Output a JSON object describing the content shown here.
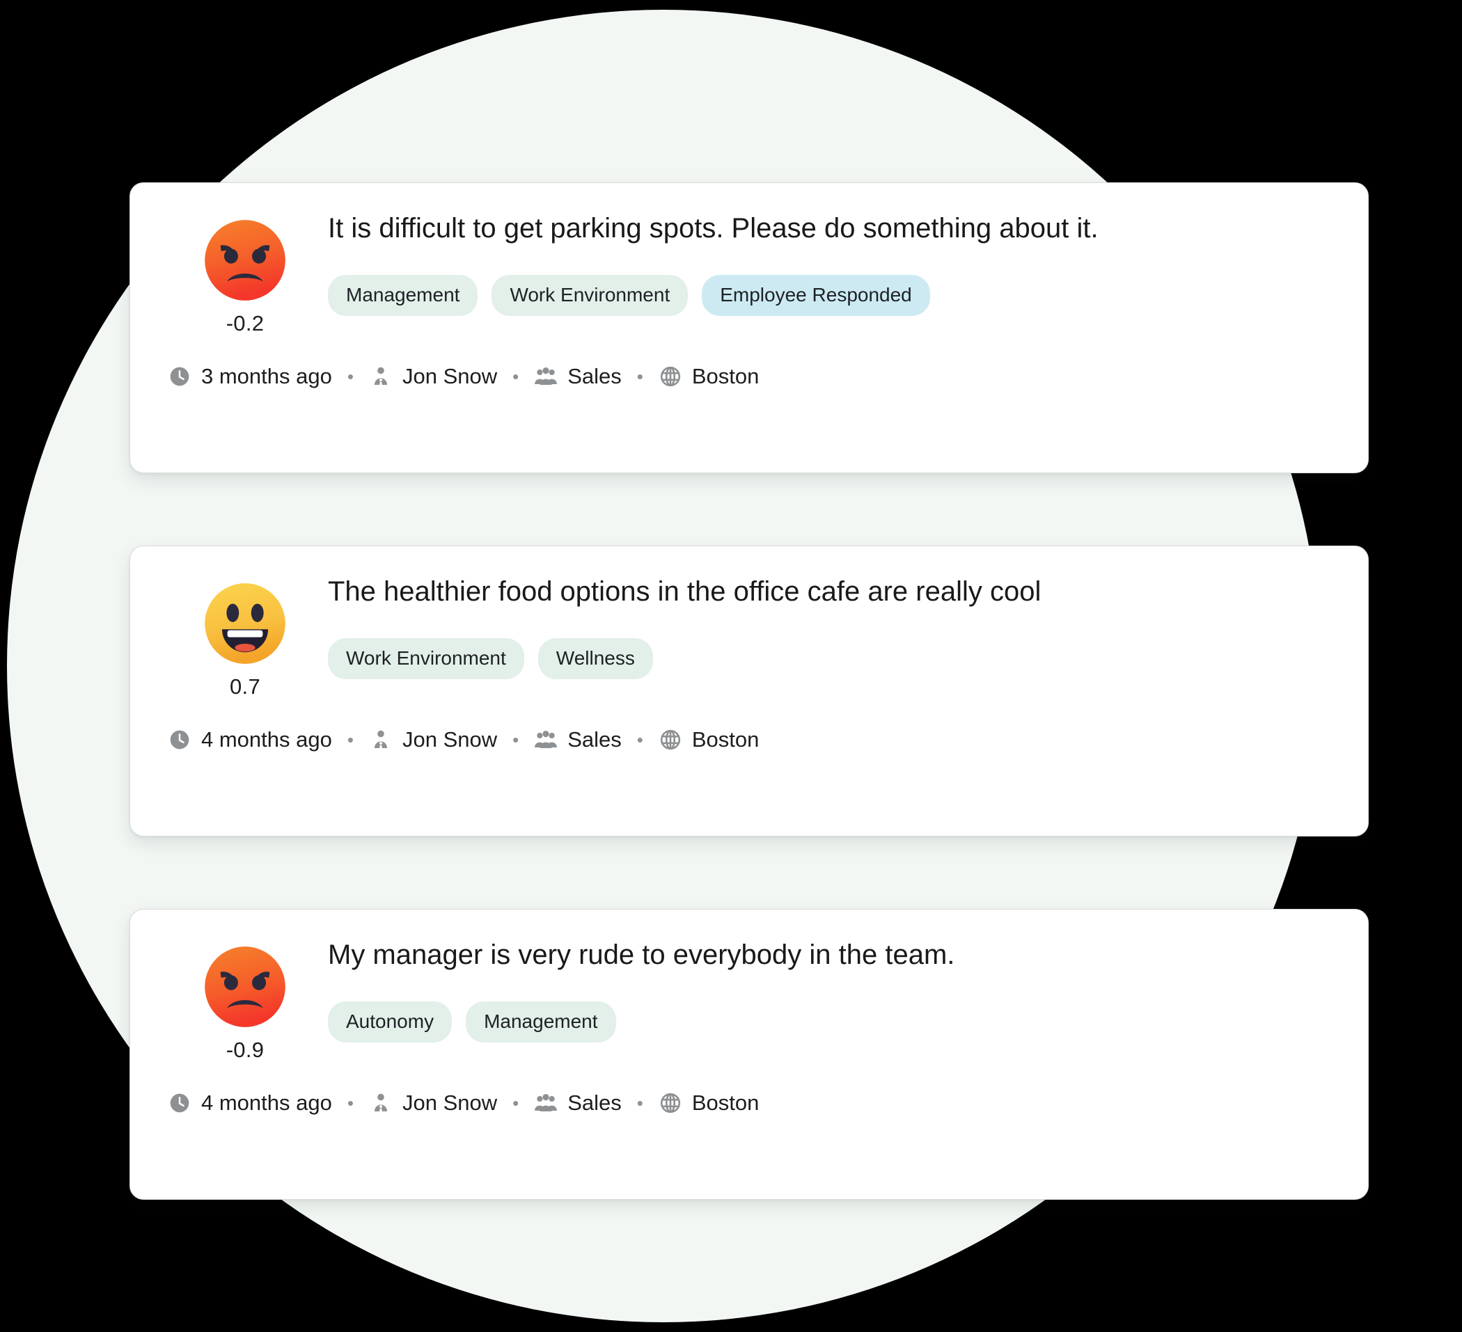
{
  "background": {
    "circle_color": "#f2f7f4",
    "page_color": "#000000"
  },
  "palette": {
    "card_bg": "#ffffff",
    "card_border": "#d9dbdb",
    "tag_green": "#e3efe9",
    "tag_blue": "#cdeaf2",
    "text_primary": "#19191b",
    "meta_text": "#1d1d1f",
    "icon_gray": "#8e9193",
    "angry_top": "#f7802b",
    "angry_bottom": "#f4382a",
    "happy_top": "#fbd34a",
    "happy_bottom": "#f5a623",
    "face_dark": "#2b2a3d",
    "tongue_red": "#e8553c"
  },
  "feedback_cards": [
    {
      "id": "card-1",
      "sentiment": {
        "emoji": "angry-face-emoji",
        "score": "-0.2"
      },
      "comment": "It is difficult to get parking spots. Please do something about it.",
      "tags": [
        {
          "label": "Management",
          "theme": "green"
        },
        {
          "label": "Work Environment",
          "theme": "green"
        },
        {
          "label": "Employee Responded",
          "theme": "blue"
        }
      ],
      "meta": {
        "time": "3 months ago",
        "person": "Jon Snow",
        "team": "Sales",
        "location": "Boston",
        "separator": "•"
      }
    },
    {
      "id": "card-2",
      "sentiment": {
        "emoji": "happy-face-emoji",
        "score": "0.7"
      },
      "comment": "The healthier food options in the office cafe are really cool",
      "tags": [
        {
          "label": "Work Environment",
          "theme": "green"
        },
        {
          "label": "Wellness",
          "theme": "green"
        }
      ],
      "meta": {
        "time": "4 months ago",
        "person": "Jon Snow",
        "team": "Sales",
        "location": "Boston",
        "separator": "•"
      }
    },
    {
      "id": "card-3",
      "sentiment": {
        "emoji": "angry-face-emoji",
        "score": "-0.9"
      },
      "comment": "My manager is very rude to everybody in the team.",
      "tags": [
        {
          "label": "Autonomy",
          "theme": "green"
        },
        {
          "label": "Management",
          "theme": "green"
        }
      ],
      "meta": {
        "time": "4 months ago",
        "person": "Jon Snow",
        "team": "Sales",
        "location": "Boston",
        "separator": "•"
      }
    }
  ],
  "icons": {
    "time": "clock-icon",
    "person": "person-tie-icon",
    "team": "people-group-icon",
    "location": "globe-icon"
  }
}
